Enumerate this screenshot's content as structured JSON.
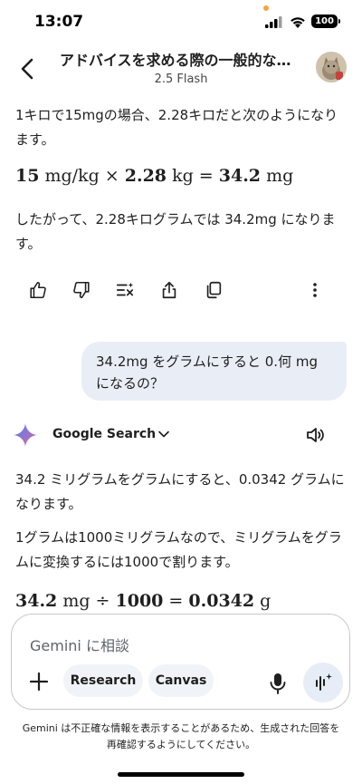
{
  "status_bar": {
    "time": "13:07",
    "battery": "100"
  },
  "header": {
    "title": "アドバイスを求める際の一般的な…",
    "model": "2.5 Flash"
  },
  "messages": {
    "p1": "1キロで15mgの場合、2.28キロだと次のようになります。",
    "math1": {
      "a": "15",
      "a_unit": " mg/kg × ",
      "b": "2.28",
      "b_unit": " kg = ",
      "c": "34.2",
      "c_unit": " mg"
    },
    "p2": "したがって、2.28キログラムでは 34.2mg になります。",
    "user": "34.2mg をグラムにすると 0.何 mg になるの？",
    "tool_label": "Google Search",
    "p3": "34.2 ミリグラムをグラムにすると、0.0342 グラムになります。",
    "p4": "1グラムは1000ミリグラムなので、ミリグラムをグラムに変換するには1000で割ります。",
    "math2": {
      "a": "34.2",
      "a_unit": " mg ÷ ",
      "b": "1000",
      "eq": " = ",
      "c": "0.0342",
      "c_unit": " g"
    }
  },
  "composer": {
    "placeholder": "Gemini に相談",
    "chip_research": "Research",
    "chip_canvas": "Canvas"
  },
  "disclaimer": "Gemini は不正確な情報を表示することがあるため、生成された回答を再確認するようにしてください。",
  "icons": {
    "actions": [
      "thumbs-up-icon",
      "thumbs-down-icon",
      "modify-response-icon",
      "share-icon",
      "copy-icon",
      "more-icon"
    ],
    "gemini_sparkle_colors": [
      "#4285f4",
      "#9b72cb",
      "#d96570"
    ],
    "accent": "#e9eef6"
  }
}
